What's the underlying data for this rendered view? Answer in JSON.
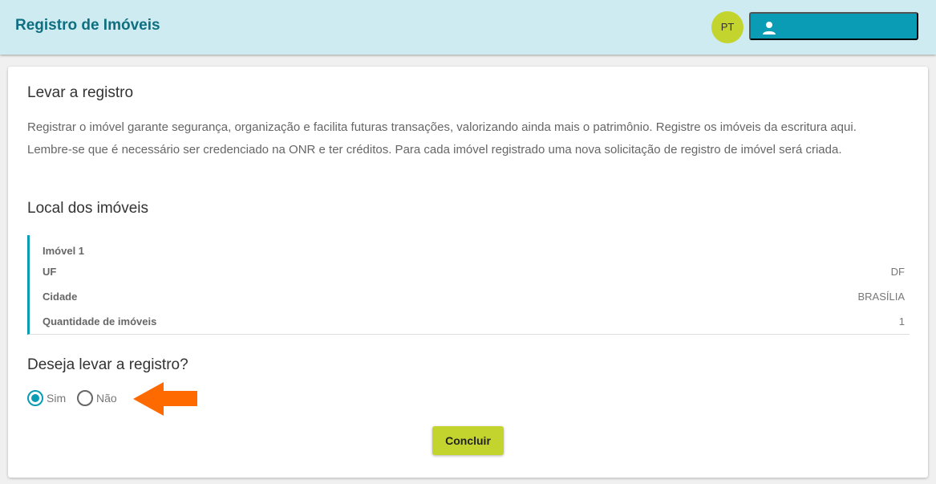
{
  "header": {
    "title": "Registro de Imóveis",
    "avatar_initials": "PT",
    "user_button_icon": "person-icon"
  },
  "section_register": {
    "title": "Levar a registro",
    "description": "Registrar o imóvel garante segurança, organização e facilita futuras transações, valorizando ainda mais o patrimônio. Registre os imóveis da escritura aqui. Lembre-se que é necessário ser credenciado na ONR e ter créditos. Para cada imóvel registrado uma nova solicitação de registro de imóvel será criada."
  },
  "section_location": {
    "title": "Local dos imóveis",
    "property_label": "Imóvel 1",
    "rows": [
      {
        "label": "UF",
        "value": "DF"
      },
      {
        "label": "Cidade",
        "value": "BRASÍLIA"
      },
      {
        "label": "Quantidade de imóveis",
        "value": "1"
      }
    ]
  },
  "question": {
    "title": "Deseja levar a registro?",
    "options": [
      {
        "label": "Sim",
        "selected": true
      },
      {
        "label": "Não",
        "selected": false
      }
    ]
  },
  "actions": {
    "conclude_label": "Concluir"
  },
  "colors": {
    "header_bg": "#cdebf0",
    "accent": "#0a9bb5",
    "avatar_bg": "#c4d42e",
    "button_bg": "#c4d42e",
    "annotation_arrow": "#ff6a00"
  }
}
